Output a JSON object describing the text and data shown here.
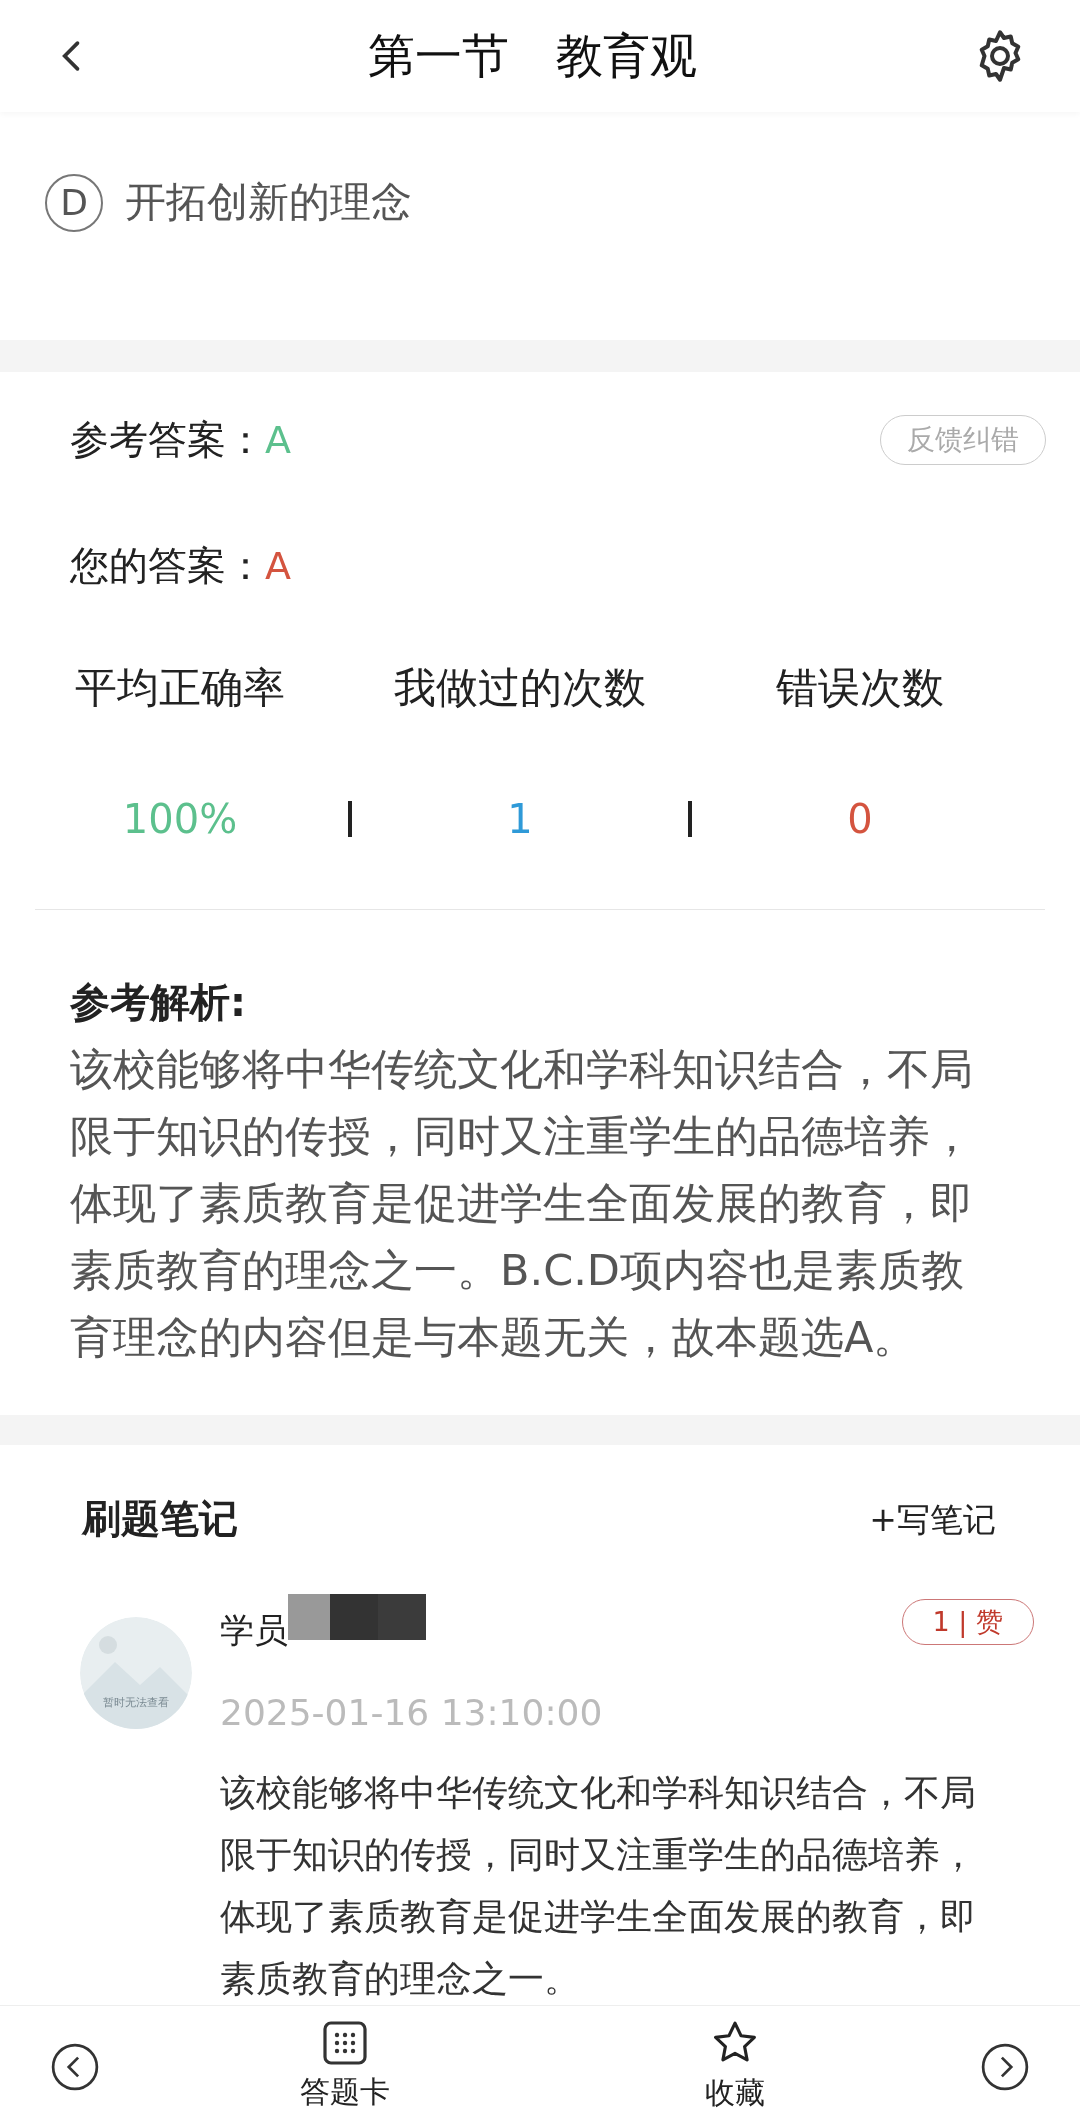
{
  "header": {
    "title": "第一节　教育观"
  },
  "options": [
    {
      "letter": "D",
      "text": "开拓创新的理念"
    }
  ],
  "answers": [
    {
      "label": "参考答案：",
      "value": "A",
      "kind": "correct"
    },
    {
      "label": "您的答案：",
      "value": "A",
      "kind": "user"
    }
  ],
  "feedback_button": "反馈纠错",
  "stats": [
    {
      "label": "平均正确率",
      "value": "100%",
      "color": "#5cc08d"
    },
    {
      "label": "我做过的次数",
      "value": "1",
      "color": "#2f9ad8"
    },
    {
      "label": "错误次数",
      "value": "0",
      "color": "#d4543f"
    }
  ],
  "analysis": {
    "title": "参考解析:",
    "text": "该校能够将中华传统文化和学科知识结合，不局限于知识的传授，同时又注重学生的品德培养，体现了素质教育是促进学生全面发展的教育，即素质教育的理念之一。B.C.D项内容也是素质教育理念的内容但是与本题无关，故本题选A。"
  },
  "notes": {
    "title": "刷题笔记",
    "write_button": "+写笔记",
    "items": [
      {
        "avatar_text": "暂时无法查看",
        "name": "学员",
        "likes": "1 | 赞",
        "time": "2025-01-16 13:10:00",
        "text": "该校能够将中华传统文化和学科知识结合，不局限于知识的传授，同时又注重学生的品德培养，体现了素质教育是促进学生全面发展的教育，即素质教育的理念之一。"
      }
    ]
  },
  "bottom_bar": [
    {
      "kind": "prev"
    },
    {
      "kind": "card",
      "label": "答题卡"
    },
    {
      "kind": "favorite",
      "label": "收藏"
    },
    {
      "kind": "next"
    }
  ]
}
